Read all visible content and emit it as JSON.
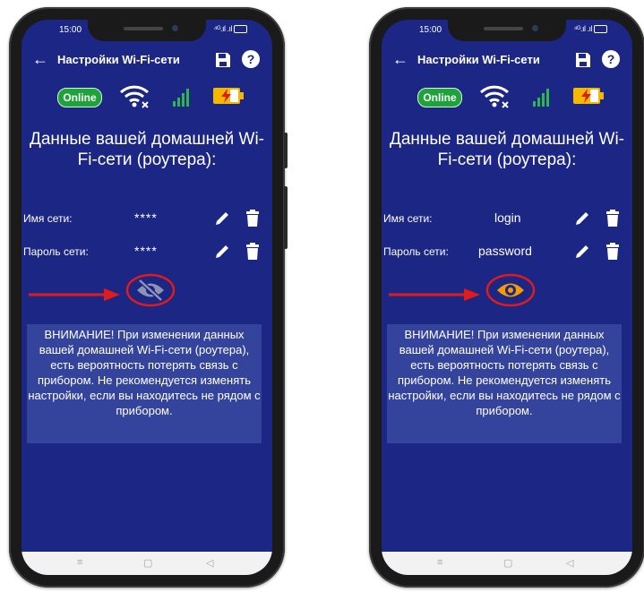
{
  "screens": [
    {
      "status_time": "15:00",
      "status_signal": "⁴ᴳ.ıl .ıl",
      "back_glyph": "←",
      "title": "Настройки Wi-Fi-сети",
      "help_glyph": "?",
      "online_label": "Online",
      "heading": "Данные вашей домашней Wi-Fi-сети (роутера):",
      "network_label": "Имя сети:",
      "network_value": "****",
      "password_label": "Пароль сети:",
      "password_value": "****",
      "eye_state": "hidden",
      "warning": "ВНИМАНИЕ! При изменении данных вашей домашней Wi-Fi-сети (роутера), есть вероятность потерять связь с прибором. Не рекомендуется изменять настройки, если вы находитесь не рядом с прибором.",
      "nav": [
        "≡",
        "▢",
        "◁"
      ]
    },
    {
      "status_time": "15:00",
      "status_signal": "⁴ᴳ.ıl .ıl",
      "back_glyph": "←",
      "title": "Настройки Wi-Fi-сети",
      "help_glyph": "?",
      "online_label": "Online",
      "heading": "Данные вашей домашней Wi-Fi-сети (роутера):",
      "network_label": "Имя сети:",
      "network_value": "login",
      "password_label": "Пароль сети:",
      "password_value": "password",
      "eye_state": "visible",
      "warning": "ВНИМАНИЕ! При изменении данных вашей домашней Wi-Fi-сети (роутера), есть вероятность потерять связь с прибором. Не рекомендуется изменять настройки, если вы находитесь не рядом с прибором.",
      "nav": [
        "≡",
        "▢",
        "◁"
      ]
    }
  ],
  "icons": {
    "back": "back-arrow-icon",
    "save": "floppy-disk-icon",
    "help": "help-circle-icon",
    "wifi": "wifi-off-icon",
    "signal": "signal-bars-icon",
    "battery": "battery-charging-icon",
    "edit": "pencil-icon",
    "trash": "trash-icon",
    "eye_hidden": "eye-off-icon",
    "eye_visible": "eye-icon",
    "arrow": "red-arrow-icon"
  },
  "colors": {
    "screen_bg": "#1b2685",
    "warning_bg": "#34449c",
    "online": "#1ea33a",
    "signal": "#2db84a",
    "battery": "#f5b800",
    "highlight": "#e01b1b",
    "eye_visible": "#f59a00",
    "eye_hidden": "#8d93b5"
  }
}
